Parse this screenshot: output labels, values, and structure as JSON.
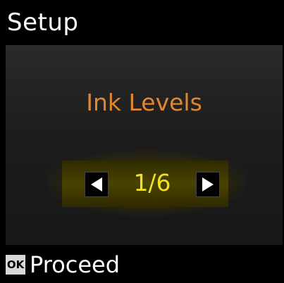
{
  "header": {
    "title": "Setup"
  },
  "menu": {
    "current_item": "Ink Levels",
    "page_indicator": "1/6",
    "prev_icon": "triangle-left-icon",
    "next_icon": "triangle-right-icon"
  },
  "footer": {
    "ok_key_label": "OK",
    "action_label": "Proceed"
  },
  "colors": {
    "item_text": "#e2862f",
    "indicator_text": "#f0e020",
    "background": "#000000"
  }
}
